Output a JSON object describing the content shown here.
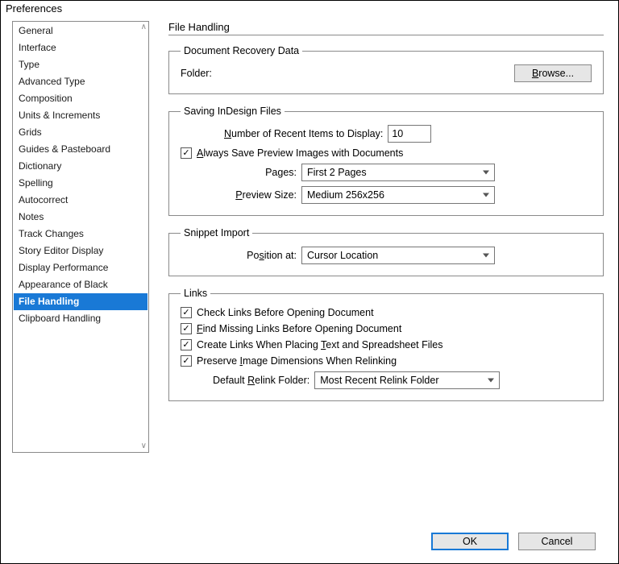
{
  "window": {
    "title": "Preferences"
  },
  "sidebar": {
    "items": [
      "General",
      "Interface",
      "Type",
      "Advanced Type",
      "Composition",
      "Units & Increments",
      "Grids",
      "Guides & Pasteboard",
      "Dictionary",
      "Spelling",
      "Autocorrect",
      "Notes",
      "Track Changes",
      "Story Editor Display",
      "Display Performance",
      "Appearance of Black",
      "File Handling",
      "Clipboard Handling"
    ],
    "selected_index": 16
  },
  "page": {
    "title": "File Handling",
    "recovery": {
      "legend": "Document Recovery Data",
      "folder_label": "Folder:",
      "browse_label": "Browse..."
    },
    "saving": {
      "legend": "Saving InDesign Files",
      "recent_label_pre": "N",
      "recent_label_post": "umber of Recent Items to Display:",
      "recent_value": "10",
      "always_preview_label_pre": "A",
      "always_preview_label_post": "lways Save Preview Images with Documents",
      "always_preview_checked": true,
      "pages_label": "Pages:",
      "pages_value": "First 2 Pages",
      "preview_size_label_pre": "P",
      "preview_size_label_post": "review Size:",
      "preview_size_value": "Medium 256x256"
    },
    "snippet": {
      "legend": "Snippet Import",
      "position_label_pre": "Po",
      "position_label_mid": "s",
      "position_label_post": "ition at:",
      "position_value": "Cursor Location"
    },
    "links": {
      "legend": "Links",
      "check_links_checked": true,
      "check_links_label": "Check Links Before Opening Document",
      "find_missing_checked": true,
      "find_missing_label_pre": "F",
      "find_missing_label_post": "ind Missing Links Before Opening Document",
      "create_links_checked": true,
      "create_links_label_pre": "Create Links When Placing ",
      "create_links_label_mid": "T",
      "create_links_label_post": "ext and Spreadsheet Files",
      "preserve_dims_checked": true,
      "preserve_dims_label_pre": "Preserve ",
      "preserve_dims_label_mid": "I",
      "preserve_dims_label_post": "mage Dimensions When Relinking",
      "relink_folder_label_pre": "Default ",
      "relink_folder_label_mid": "R",
      "relink_folder_label_post": "elink Folder:",
      "relink_folder_value": "Most Recent Relink Folder"
    }
  },
  "footer": {
    "ok": "OK",
    "cancel": "Cancel"
  }
}
